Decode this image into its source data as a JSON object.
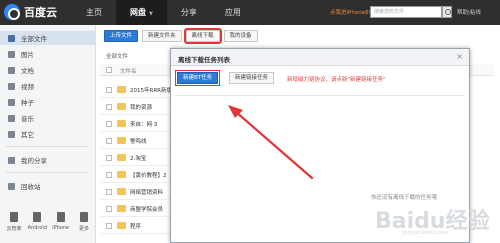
{
  "app": {
    "logo_text": "百度云"
  },
  "nav": {
    "items": [
      {
        "label": "主页"
      },
      {
        "label": "网盘",
        "active": true
      },
      {
        "label": "分享"
      },
      {
        "label": "应用"
      }
    ],
    "user_text": "点我进iPhone6!",
    "search_placeholder": "搜索您的文件",
    "help_label": "帮助|粘线"
  },
  "sidebar": {
    "items": [
      {
        "label": "全部文件",
        "icon": "folder-icon",
        "active": true
      },
      {
        "label": "图片",
        "icon": "image-icon"
      },
      {
        "label": "文档",
        "icon": "document-icon"
      },
      {
        "label": "视频",
        "icon": "video-icon"
      },
      {
        "label": "种子",
        "icon": "torrent-icon"
      },
      {
        "label": "音乐",
        "icon": "music-icon"
      },
      {
        "label": "其它",
        "icon": "other-icon"
      },
      {
        "label": "我的分享",
        "icon": "share-icon"
      },
      {
        "label": "回收站",
        "icon": "trash-icon"
      }
    ],
    "devices": [
      {
        "label": "云管家",
        "icon": "desktop-icon"
      },
      {
        "label": "Android",
        "icon": "android-icon"
      },
      {
        "label": "iPhone",
        "icon": "iphone-icon"
      },
      {
        "label": "更多",
        "icon": "more-icon"
      }
    ]
  },
  "toolbar": {
    "upload_label": "上传文件",
    "new_folder_label": "新建文件夹",
    "offline_label": "离线下载",
    "device_label": "我的设备"
  },
  "file_list": {
    "breadcrumb": "全部文件",
    "header_label": "文件名",
    "rows": [
      "2015年RRR新版",
      "我的资源",
      "来自：网 3",
      "警鸣线",
      "2.淘宝",
      "【黄价教程】2",
      "网络营销资料",
      "商盟学院会员",
      "程序"
    ]
  },
  "dialog": {
    "title": "离线下载任务列表",
    "close_glyph": "×",
    "new_bt_label": "新建BT任务",
    "new_link_label": "新建链接任务",
    "notice": "新增磁力链协议，请点新\"新建链接任务\"",
    "empty_text": "你还没有离线下载的任务哦"
  },
  "colors": {
    "top_bar": "#2f2f2f",
    "primary": "#2e7bd6",
    "highlight": "#e03636",
    "folder": "#f0c659"
  },
  "watermark": {
    "text": "Baidu经验",
    "sub": "jingyan.baidu.com"
  }
}
